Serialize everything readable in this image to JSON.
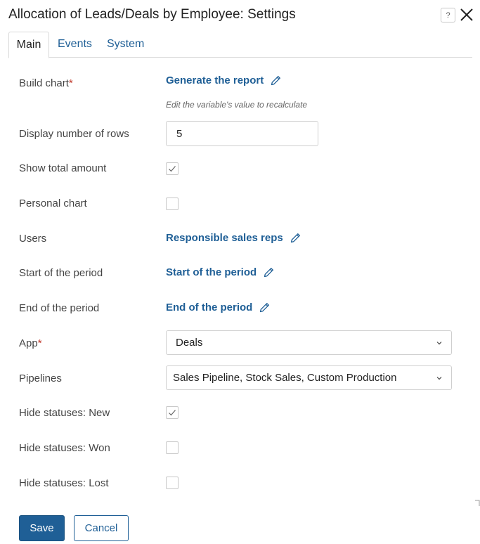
{
  "dialog": {
    "title": "Allocation of Leads/Deals by Employee: Settings",
    "help_label": "?"
  },
  "tabs": [
    {
      "label": "Main",
      "active": true
    },
    {
      "label": "Events",
      "active": false
    },
    {
      "label": "System",
      "active": false
    }
  ],
  "fields": {
    "build_chart": {
      "label": "Build chart",
      "required_mark": "*",
      "value": "Generate the report",
      "hint": "Edit the variable's value to recalculate"
    },
    "display_rows": {
      "label": "Display number of rows",
      "value": "5"
    },
    "show_total": {
      "label": "Show total amount",
      "checked": true
    },
    "personal_chart": {
      "label": "Personal chart",
      "checked": false
    },
    "users": {
      "label": "Users",
      "value": "Responsible sales reps"
    },
    "start_period": {
      "label": "Start of the period",
      "value": "Start of the period"
    },
    "end_period": {
      "label": "End of the period",
      "value": "End of the period"
    },
    "app": {
      "label": "App",
      "required_mark": "*",
      "value": "Deals"
    },
    "pipelines": {
      "label": "Pipelines",
      "value": "Sales Pipeline, Stock Sales, Custom Production"
    },
    "hide_new": {
      "label": "Hide statuses: New",
      "checked": true
    },
    "hide_won": {
      "label": "Hide statuses: Won",
      "checked": false
    },
    "hide_lost": {
      "label": "Hide statuses: Lost",
      "checked": false
    }
  },
  "footer": {
    "save_label": "Save",
    "cancel_label": "Cancel"
  },
  "colors": {
    "accent": "#1f5f96",
    "required": "#c0392b",
    "border": "#cfcfcf"
  },
  "icons": {
    "help": "help-icon",
    "close": "close-icon",
    "edit": "pencil-icon",
    "dropdown": "chevron-down-icon",
    "check": "check-icon"
  }
}
